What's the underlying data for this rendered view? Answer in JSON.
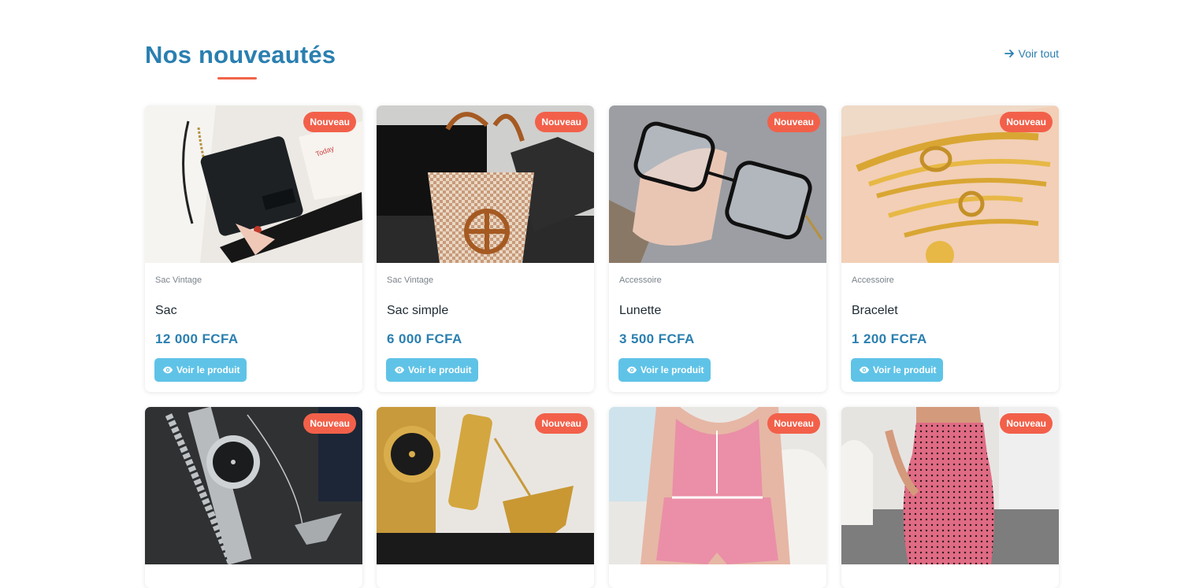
{
  "section": {
    "title": "Nos nouveautés",
    "see_all_label": "Voir tout"
  },
  "badge_label": "Nouveau",
  "view_button_label": "Voir le produit",
  "colors": {
    "primary": "#2a7fb0",
    "accent": "#f06448",
    "button": "#5fc3e7"
  },
  "products": [
    {
      "category": "Sac Vintage",
      "name": "Sac",
      "price": "12 000 FCFA",
      "image": "black-crossbody-bag"
    },
    {
      "category": "Sac Vintage",
      "name": "Sac simple",
      "price": "6 000 FCFA",
      "image": "checkered-tote-bag"
    },
    {
      "category": "Accessoire",
      "name": "Lunette",
      "price": "3 500 FCFA",
      "image": "eyeglasses"
    },
    {
      "category": "Accessoire",
      "name": "Bracelet",
      "price": "1 200 FCFA",
      "image": "gold-bracelets"
    },
    {
      "image": "silver-watch-set"
    },
    {
      "image": "gold-watch-set"
    },
    {
      "image": "pink-pajama-set"
    },
    {
      "image": "pink-dotted-dress"
    }
  ]
}
